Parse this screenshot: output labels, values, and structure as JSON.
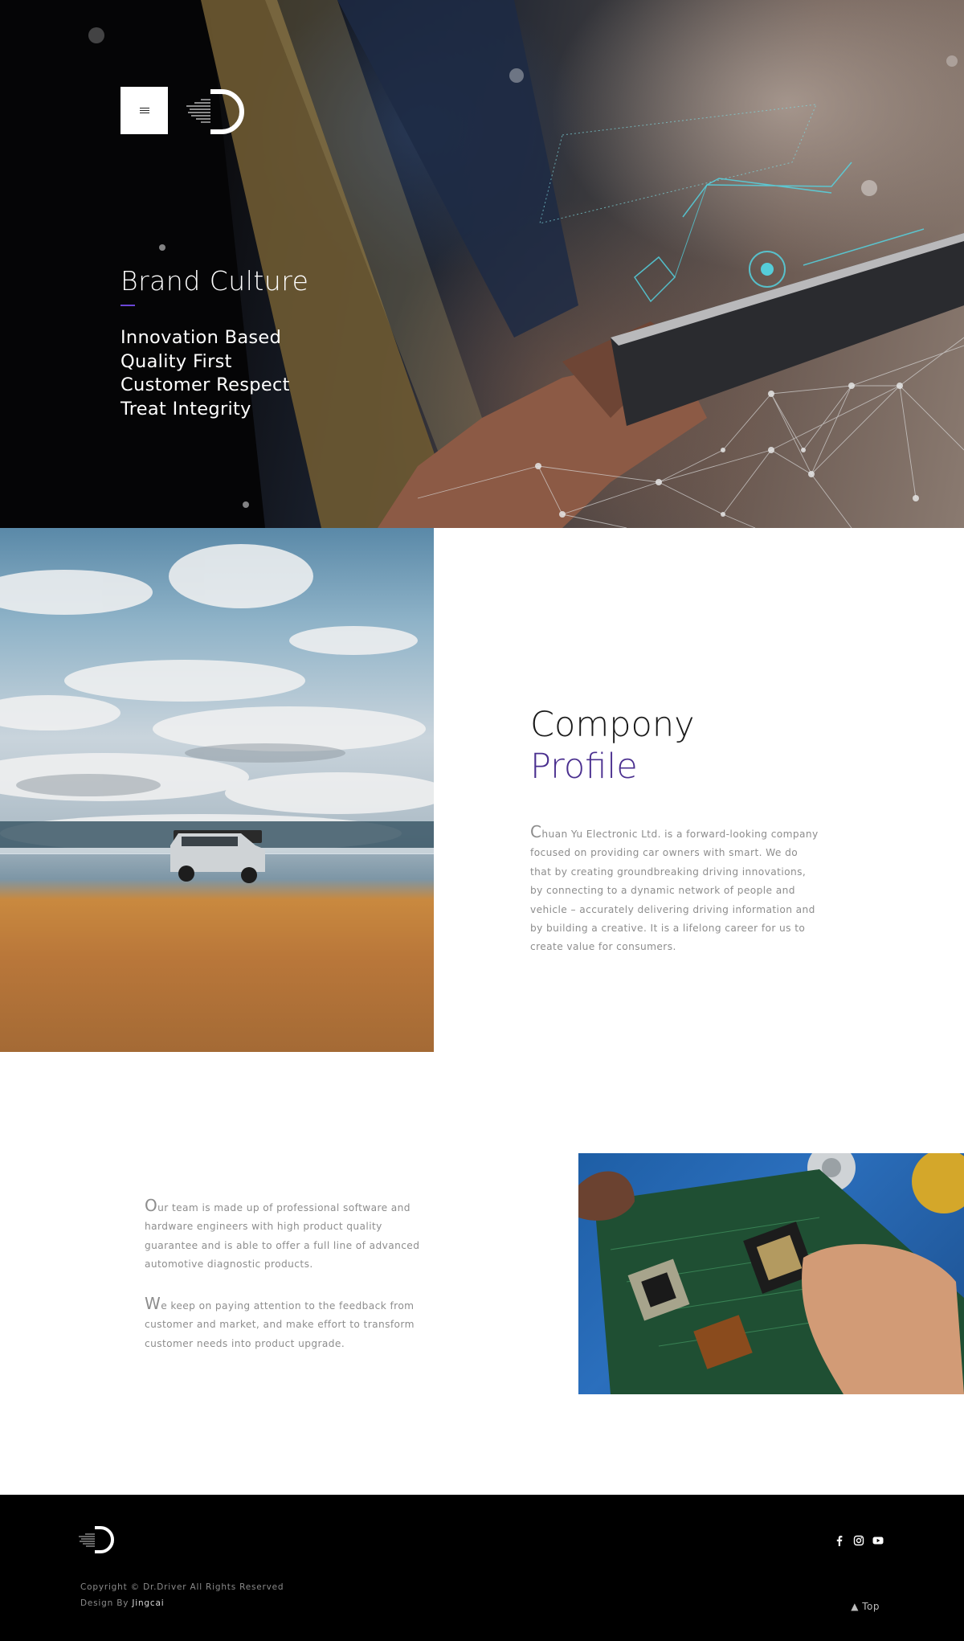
{
  "hero": {
    "title": "Brand Culture",
    "values": [
      "Innovation Based",
      "Quality First",
      "Customer Respect",
      "Treat Integrity"
    ],
    "menu_icon": "hamburger-icon",
    "logo_icon": "dr-driver-logo",
    "accent_color": "#6b46d6"
  },
  "profile": {
    "title_line1": "Compony",
    "title_line2": "Profile",
    "accent_color": "#4a2f8f",
    "paragraph_initial": "C",
    "paragraph_rest": "huan Yu Electronic Ltd. is a forward-looking company focused on providing car owners with smart. We do that by creating groundbreaking driving innovations, by connecting to a dynamic network of people and vehicle – accurately delivering driving information and by building a creative. It is a lifelong career for us to create value for consumers."
  },
  "team": {
    "paragraph1_initial": "O",
    "paragraph1_rest": "ur team is made up of professional software and hardware engineers with high product quality guarantee and is able to offer a full line of advanced automotive diagnostic products.",
    "paragraph2_initial": "W",
    "paragraph2_rest": "e keep on paying attention to the feedback from customer and market, and make effort to transform customer needs into product upgrade."
  },
  "footer": {
    "copyright": "Copyright © Dr.Driver All Rights Reserved",
    "design_by_label": "Design By",
    "design_by_name": "Jingcai",
    "social_icons": [
      "facebook-icon",
      "instagram-icon",
      "youtube-icon"
    ],
    "top_label": "Top"
  }
}
